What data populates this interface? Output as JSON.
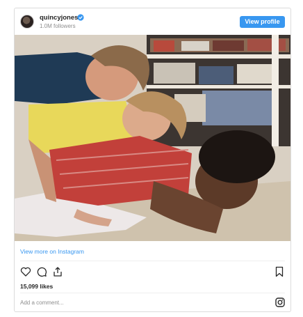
{
  "header": {
    "username": "quincyjones",
    "followers": "1.0M followers",
    "profile_button": "View profile"
  },
  "post": {
    "image_alt": "",
    "view_more": "View more on Instagram",
    "likes": "15,099 likes",
    "comment_placeholder": "Add a comment..."
  },
  "icons": {
    "verified": "verified-badge-icon",
    "like": "heart-icon",
    "comment": "comment-icon",
    "share": "share-icon",
    "save": "bookmark-icon",
    "instagram": "instagram-icon"
  },
  "colors": {
    "link": "#3897f0",
    "button": "#3897f0",
    "border": "#dbdbdb"
  }
}
